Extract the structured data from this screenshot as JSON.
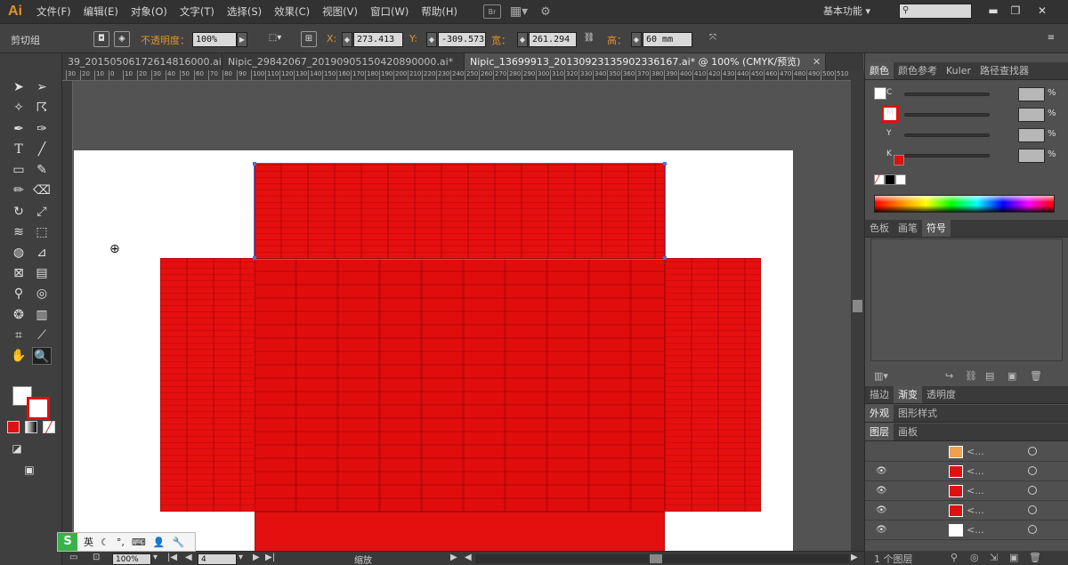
{
  "app": {
    "logo": "Ai"
  },
  "menu": [
    "文件(F)",
    "编辑(E)",
    "对象(O)",
    "文字(T)",
    "选择(S)",
    "效果(C)",
    "视图(V)",
    "窗口(W)",
    "帮助(H)"
  ],
  "menubar_icons": {
    "bridge": "Br"
  },
  "workspace": {
    "label": "基本功能",
    "arrow": "▾"
  },
  "control": {
    "mode_label": "剪切组",
    "opacity_label": "不透明度：",
    "opacity_value": "100%",
    "x_label": "X:",
    "x_value": "273.413",
    "y_label": "Y:",
    "y_value": "-309.573",
    "w_label": "宽：",
    "w_value": "261.294",
    "h_label": "高：",
    "h_value": "60 mm"
  },
  "tabs": [
    {
      "label": "39_20150506172614816000.ai*",
      "active": false
    },
    {
      "label": "Nipic_29842067_20190905150420890000.ai*",
      "active": false
    },
    {
      "label": "Nipic_13699913_20130923135902336167.ai* @ 100% (CMYK/预览)",
      "active": true
    }
  ],
  "ruler": [
    "30",
    "20",
    "10",
    "0",
    "10",
    "20",
    "30",
    "40",
    "50",
    "60",
    "70",
    "80",
    "90",
    "100",
    "110",
    "120",
    "130",
    "140",
    "150",
    "160",
    "170",
    "180",
    "190",
    "200",
    "210",
    "220",
    "230",
    "240",
    "250",
    "260",
    "270",
    "280",
    "290",
    "300",
    "310",
    "320",
    "330",
    "340",
    "350",
    "360",
    "370",
    "380",
    "390",
    "400",
    "410",
    "420",
    "430",
    "440",
    "450",
    "460",
    "470",
    "480",
    "490",
    "500",
    "510"
  ],
  "status": {
    "zoom": "100%",
    "page": "4",
    "tool_name": "缩放"
  },
  "ime": {
    "logo": "S",
    "lang": "英"
  },
  "panels": {
    "color_tabs": [
      "颜色",
      "颜色参考",
      "Kuler",
      "路径查找器"
    ],
    "cmyk": [
      {
        "label": "C",
        "unit": "%"
      },
      {
        "label": "M",
        "unit": "%"
      },
      {
        "label": "Y",
        "unit": "%"
      },
      {
        "label": "K",
        "unit": "%"
      }
    ],
    "swatch_tabs": [
      "色板",
      "画笔",
      "符号"
    ],
    "stroke_tabs": [
      "描边",
      "渐变",
      "透明度"
    ],
    "appearance_tabs": [
      "外观",
      "图形样式"
    ],
    "layers_tabs": [
      "图层",
      "画板"
    ],
    "layers_footer": "1 个图层",
    "layer_rows": [
      "<...",
      "<...",
      "<...",
      "<...",
      "<..."
    ]
  },
  "colors": {
    "accent_red": "#e60f0f",
    "selection_blue": "#4a6fe0",
    "brand_orange": "#e0912a"
  }
}
